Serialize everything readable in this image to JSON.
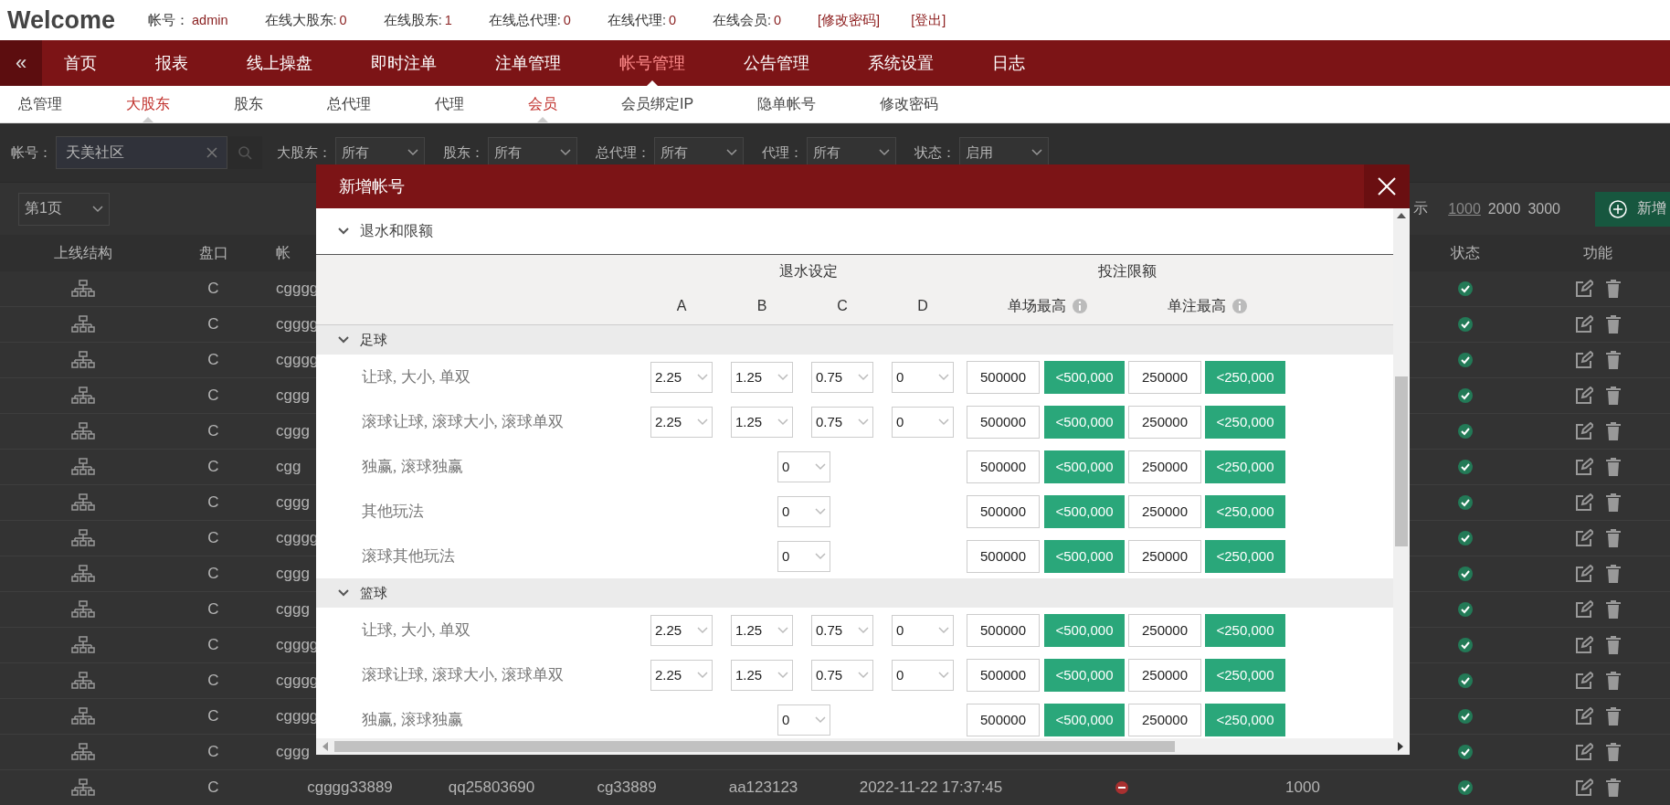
{
  "header": {
    "title": "Welcome",
    "stats": [
      {
        "label": "帐号：",
        "value": "admin"
      },
      {
        "label": "在线大股东:",
        "value": "0"
      },
      {
        "label": "在线股东:",
        "value": "1"
      },
      {
        "label": "在线总代理:",
        "value": "0"
      },
      {
        "label": "在线代理:",
        "value": "0"
      },
      {
        "label": "在线会员:",
        "value": "0"
      }
    ],
    "links": [
      "[修改密码]",
      "[登出]"
    ]
  },
  "nav": {
    "collapse": "«",
    "items": [
      {
        "label": "首页",
        "selected": false
      },
      {
        "label": "报表",
        "selected": false
      },
      {
        "label": "线上操盘",
        "selected": false
      },
      {
        "label": "即时注单",
        "selected": false
      },
      {
        "label": "注单管理",
        "selected": false
      },
      {
        "label": "帐号管理",
        "selected": true
      },
      {
        "label": "公告管理",
        "selected": false
      },
      {
        "label": "系统设置",
        "selected": false
      },
      {
        "label": "日志",
        "selected": false
      }
    ]
  },
  "subnav": [
    {
      "label": "总管理",
      "selected": false
    },
    {
      "label": "大股东",
      "selected": true
    },
    {
      "label": "股东",
      "selected": false
    },
    {
      "label": "总代理",
      "selected": false
    },
    {
      "label": "代理",
      "selected": false
    },
    {
      "label": "会员",
      "selected": true
    },
    {
      "label": "会员绑定IP",
      "selected": false
    },
    {
      "label": "隐单帐号",
      "selected": false
    },
    {
      "label": "修改密码",
      "selected": false
    }
  ],
  "filters": [
    {
      "kind": "search",
      "label": "帐号：",
      "value": "天美社区"
    },
    {
      "kind": "select",
      "label": "大股东：",
      "value": "所有"
    },
    {
      "kind": "select",
      "label": "股东：",
      "value": "所有"
    },
    {
      "kind": "select",
      "label": "总代理：",
      "value": "所有"
    },
    {
      "kind": "select",
      "label": "代理：",
      "value": "所有"
    },
    {
      "kind": "select",
      "label": "状态：",
      "value": "启用"
    }
  ],
  "pager": {
    "page": "第1页",
    "show_label": "示",
    "sizes": [
      {
        "label": "1000",
        "selected": true
      },
      {
        "label": "2000",
        "selected": false
      },
      {
        "label": "3000",
        "selected": false
      }
    ],
    "add_button": "新增"
  },
  "table": {
    "columns": [
      "上线结构",
      "盘口",
      "帐",
      "状态",
      "功能"
    ],
    "rows": [
      {
        "handicap": "C",
        "account": "cgggg",
        "enabled": true
      },
      {
        "handicap": "C",
        "account": "cgggg",
        "enabled": true
      },
      {
        "handicap": "C",
        "account": "cgggg",
        "enabled": true
      },
      {
        "handicap": "C",
        "account": "cggg",
        "enabled": true
      },
      {
        "handicap": "C",
        "account": "cggg",
        "enabled": true
      },
      {
        "handicap": "C",
        "account": "cgg",
        "enabled": true
      },
      {
        "handicap": "C",
        "account": "cggg",
        "enabled": true
      },
      {
        "handicap": "C",
        "account": "cgggg",
        "enabled": true
      },
      {
        "handicap": "C",
        "account": "cggg",
        "enabled": true
      },
      {
        "handicap": "C",
        "account": "cggg",
        "enabled": true
      },
      {
        "handicap": "C",
        "account": "cgggg",
        "enabled": true
      },
      {
        "handicap": "C",
        "account": "cgggg",
        "enabled": true
      },
      {
        "handicap": "C",
        "account": "cgggg",
        "enabled": true
      },
      {
        "handicap": "C",
        "account": "cggg",
        "enabled": true
      },
      {
        "handicap": "C",
        "account": "cgggg33889",
        "column_4": "qq25803690",
        "column_5": "cg33889",
        "column_6": "aa123123",
        "column_7": "2022-11-22 17:37:45",
        "online": false,
        "column_9": "1000",
        "enabled": true
      }
    ]
  },
  "modal": {
    "title": "新增帐号",
    "section": {
      "title": "退水和限额",
      "expanded": true
    },
    "rebate_title": "退水设定",
    "limit_title": "投注限额",
    "rebate_columns": [
      "A",
      "B",
      "C",
      "D"
    ],
    "limit_columns": [
      "单场最高",
      "单注最高"
    ],
    "groups": [
      {
        "name": "足球",
        "expanded": true,
        "rows": [
          {
            "kind": "multi",
            "label": "让球, 大小, 单双",
            "rebates": [
              "2.25",
              "1.25",
              "0.75",
              "0"
            ],
            "match_max": "500000",
            "match_cap": "<500,000",
            "bet_max": "250000",
            "bet_cap": "<250,000"
          },
          {
            "kind": "multi",
            "label": "滚球让球, 滚球大小, 滚球单双",
            "rebates": [
              "2.25",
              "1.25",
              "0.75",
              "0"
            ],
            "match_max": "500000",
            "match_cap": "<500,000",
            "bet_max": "250000",
            "bet_cap": "<250,000"
          },
          {
            "kind": "single",
            "label": "独赢, 滚球独赢",
            "rebates": [
              "0"
            ],
            "match_max": "500000",
            "match_cap": "<500,000",
            "bet_max": "250000",
            "bet_cap": "<250,000"
          },
          {
            "kind": "single",
            "label": "其他玩法",
            "rebates": [
              "0"
            ],
            "match_max": "500000",
            "match_cap": "<500,000",
            "bet_max": "250000",
            "bet_cap": "<250,000"
          },
          {
            "kind": "single",
            "label": "滚球其他玩法",
            "rebates": [
              "0"
            ],
            "match_max": "500000",
            "match_cap": "<500,000",
            "bet_max": "250000",
            "bet_cap": "<250,000"
          }
        ]
      },
      {
        "name": "篮球",
        "expanded": true,
        "rows": [
          {
            "kind": "multi",
            "label": "让球, 大小, 单双",
            "rebates": [
              "2.25",
              "1.25",
              "0.75",
              "0"
            ],
            "match_max": "500000",
            "match_cap": "<500,000",
            "bet_max": "250000",
            "bet_cap": "<250,000"
          },
          {
            "kind": "multi",
            "label": "滚球让球, 滚球大小, 滚球单双",
            "rebates": [
              "2.25",
              "1.25",
              "0.75",
              "0"
            ],
            "match_max": "500000",
            "match_cap": "<500,000",
            "bet_max": "250000",
            "bet_cap": "<250,000"
          },
          {
            "kind": "single",
            "label": "独赢, 滚球独赢",
            "rebates": [
              "0"
            ],
            "match_max": "500000",
            "match_cap": "<500,000",
            "bet_max": "250000",
            "bet_cap": "<250,000"
          }
        ]
      }
    ]
  }
}
